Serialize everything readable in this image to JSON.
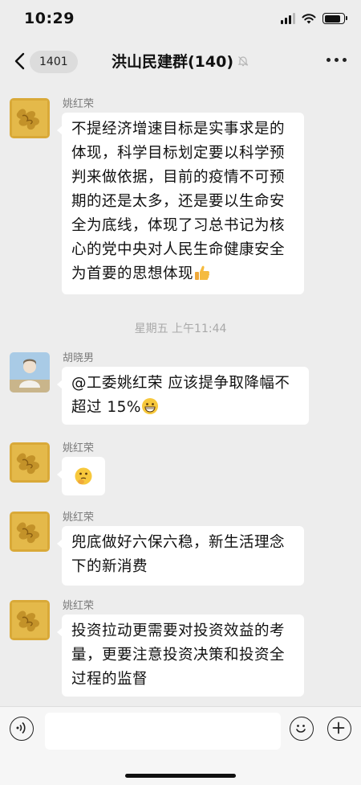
{
  "status_bar": {
    "time": "10:29"
  },
  "nav": {
    "unread_count": "1401",
    "title": "洪山民建群(140)"
  },
  "messages": [
    {
      "sender": "姚红荣",
      "text": "不提经济增速目标是实事求是的体现，科学目标划定要以科学预判来做依据，目前的疫情不可预期的还是太多，还是要以生命安全为底线，体现了习总书记为核心的党中央对人民生命健康安全为首要的思想体现",
      "emoji": "thumbs-up"
    },
    {
      "sender": "胡晓男",
      "text": "@工委姚红荣 应该提争取降幅不超过 15%",
      "emoji": "grin"
    },
    {
      "sender": "姚红荣",
      "text": "",
      "emoji": "thinking"
    },
    {
      "sender": "姚红荣",
      "text": "兜底做好六保六稳，新生活理念下的新消费"
    },
    {
      "sender": "姚红荣",
      "text": "投资拉动更需要对投资效益的考量，更要注意投资决策和投资全过程的监督"
    }
  ],
  "time_separator": "星期五 上午11:44",
  "input": {
    "placeholder": ""
  },
  "icons": {
    "back": "chevron-left-icon",
    "mute": "mute-bell-icon",
    "more": "more-dots-icon",
    "voice": "voice-icon",
    "emoji": "emoji-icon",
    "plus": "plus-icon"
  },
  "colors": {
    "background": "#ededed",
    "bubble": "#ffffff",
    "input_bar": "#f6f6f6"
  }
}
